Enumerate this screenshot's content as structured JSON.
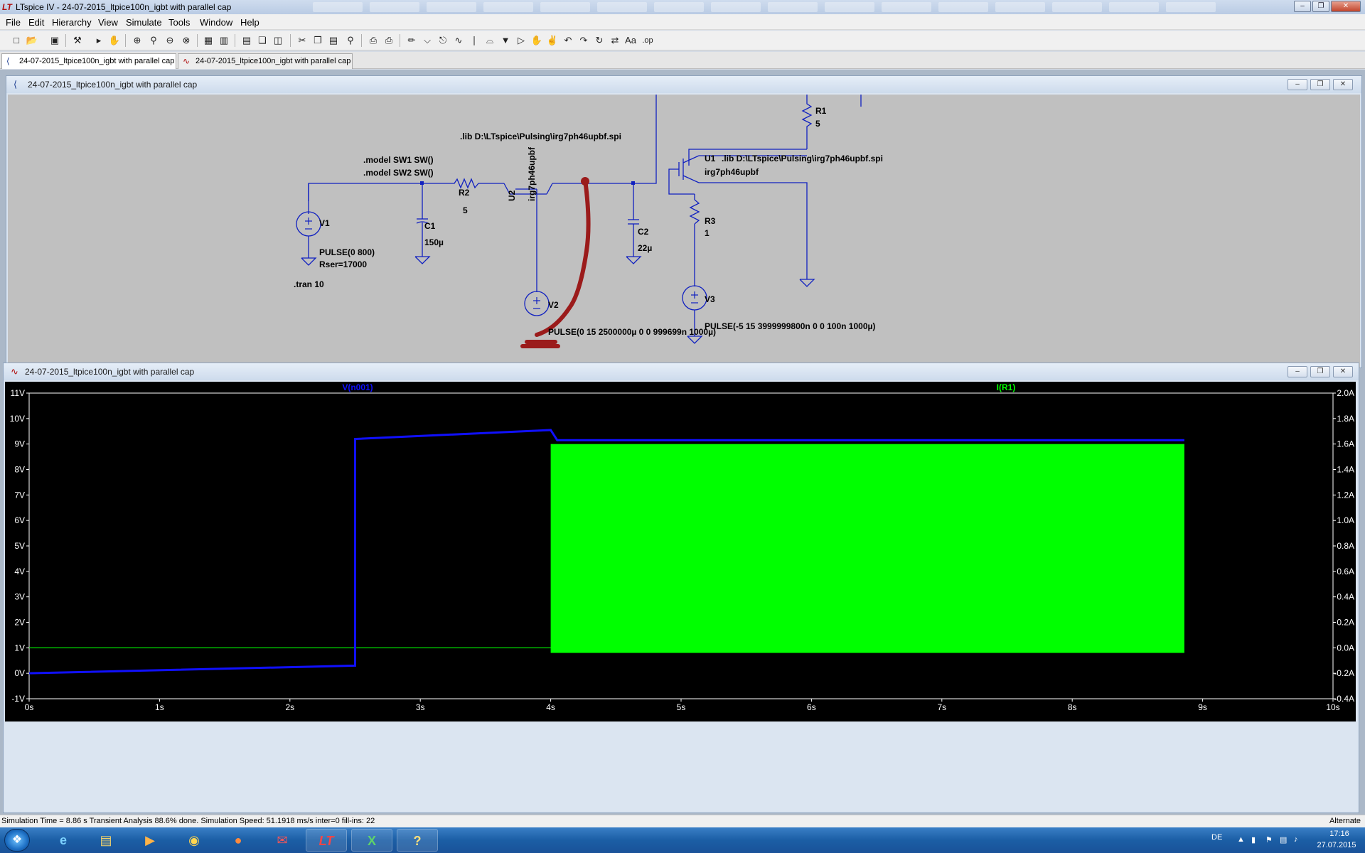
{
  "titlebar": {
    "app_icon": "ltspice-logo-icon",
    "title": "LTspice IV - 24-07-2015_ltpice100n_igbt with parallel cap",
    "controls": [
      "minimize-icon",
      "restore-icon",
      "close-icon"
    ]
  },
  "menu": [
    "File",
    "Edit",
    "Hierarchy",
    "View",
    "Simulate",
    "Tools",
    "Window",
    "Help"
  ],
  "tabs": [
    {
      "label": "24-07-2015_ltpice100n_igbt with parallel cap",
      "icon": "schematic-icon"
    },
    {
      "label": "24-07-2015_ltpice100n_igbt with parallel cap",
      "icon": "waveform-icon"
    }
  ],
  "schematic_window": {
    "title": "24-07-2015_ltpice100n_igbt with parallel cap",
    "labels": {
      "V1": "V1",
      "V1_value1": "PULSE(0 800)",
      "V1_value2": "Rser=17000",
      "tran": ".tran 10",
      "C1": "C1",
      "C1_value": "150µ",
      "R2": "R2",
      "R2_value": "5",
      "model1": ".model SW1 SW()",
      "model2": ".model SW2 SW()",
      "lib_top": ".lib D:\\LTspice\\Pulsing\\irg7ph46upbf.spi",
      "U2": "U2",
      "U2_value": "irg7ph46upbf",
      "V2": "V2",
      "V2_value": "PULSE(0 15 2500000µ 0 0 999699n 1000µ)",
      "C2": "C2",
      "C2_value": "22µ",
      "R1": "R1",
      "R1_value": "5",
      "U1": "U1",
      "U1_lib": ".lib D:\\LTspice\\Pulsing\\irg7ph46upbf.spi",
      "U1_value": "irg7ph46upbf",
      "R3": "R3",
      "R3_value": "1",
      "V3": "V3",
      "V3_value": "PULSE(-5 15 3999999800n 0 0 100n 1000µ)"
    },
    "colors": {
      "wire": "#1020c0",
      "background": "#c0c0c0",
      "annotation": "#9b1b1b"
    }
  },
  "plot_window": {
    "title": "24-07-2015_ltpice100n_igbt with parallel cap",
    "trace_labels": {
      "left": "V(n001)",
      "right": "I(R1)"
    },
    "colors": {
      "voltage": "#1010ff",
      "current": "#00ff00",
      "grid_text": "#ffffff",
      "background": "#000000"
    }
  },
  "chart_data": {
    "type": "line",
    "title": "",
    "x_ticks": [
      "0s",
      "1s",
      "2s",
      "3s",
      "4s",
      "5s",
      "6s",
      "7s",
      "8s",
      "9s",
      "10s"
    ],
    "y_left_ticks": [
      "11V",
      "10V",
      "9V",
      "8V",
      "7V",
      "6V",
      "5V",
      "4V",
      "3V",
      "2V",
      "1V",
      "0V",
      "-1V"
    ],
    "y_right_ticks": [
      "2.0A",
      "1.8A",
      "1.6A",
      "1.4A",
      "1.2A",
      "1.0A",
      "0.8A",
      "0.6A",
      "0.4A",
      "0.2A",
      "0.0A",
      "-0.2A",
      "-0.4A"
    ],
    "xlim": [
      0,
      10
    ],
    "ylim_left": [
      -1,
      11
    ],
    "ylim_right": [
      -0.4,
      2.0
    ],
    "series": [
      {
        "name": "V(n001)",
        "axis": "left",
        "points": [
          [
            0,
            0.0
          ],
          [
            2.5,
            0.3
          ],
          [
            2.5,
            9.2
          ],
          [
            4.0,
            9.55
          ],
          [
            4.05,
            9.15
          ],
          [
            8.86,
            9.15
          ]
        ]
      },
      {
        "name": "I(R1)",
        "axis": "right",
        "points": [
          [
            0,
            0.0
          ],
          [
            2.5,
            0.0
          ],
          [
            2.5,
            0.25
          ],
          [
            2.5,
            0.0
          ],
          [
            4.0,
            0.0
          ]
        ],
        "band": {
          "x_start": 4.0,
          "x_end": 8.86,
          "low": -0.04,
          "high": 1.6
        }
      }
    ]
  },
  "status": {
    "text": "Simulation Time = 8.86 s  Transient Analysis 88.6% done. Simulation Speed: 51.1918 ms/s inter=0 fill-ins: 22",
    "mode": "Alternate"
  },
  "taskbar": {
    "apps": [
      "windows-media-player-icon",
      "internet-explorer-icon",
      "file-explorer-icon",
      "media-player-icon",
      "chrome-icon",
      "firefox-icon",
      "mail-icon",
      "ltspice-icon",
      "excel-icon",
      "help-icon"
    ],
    "lang": "DE",
    "time": "17:16",
    "date": "27.07.2015"
  }
}
